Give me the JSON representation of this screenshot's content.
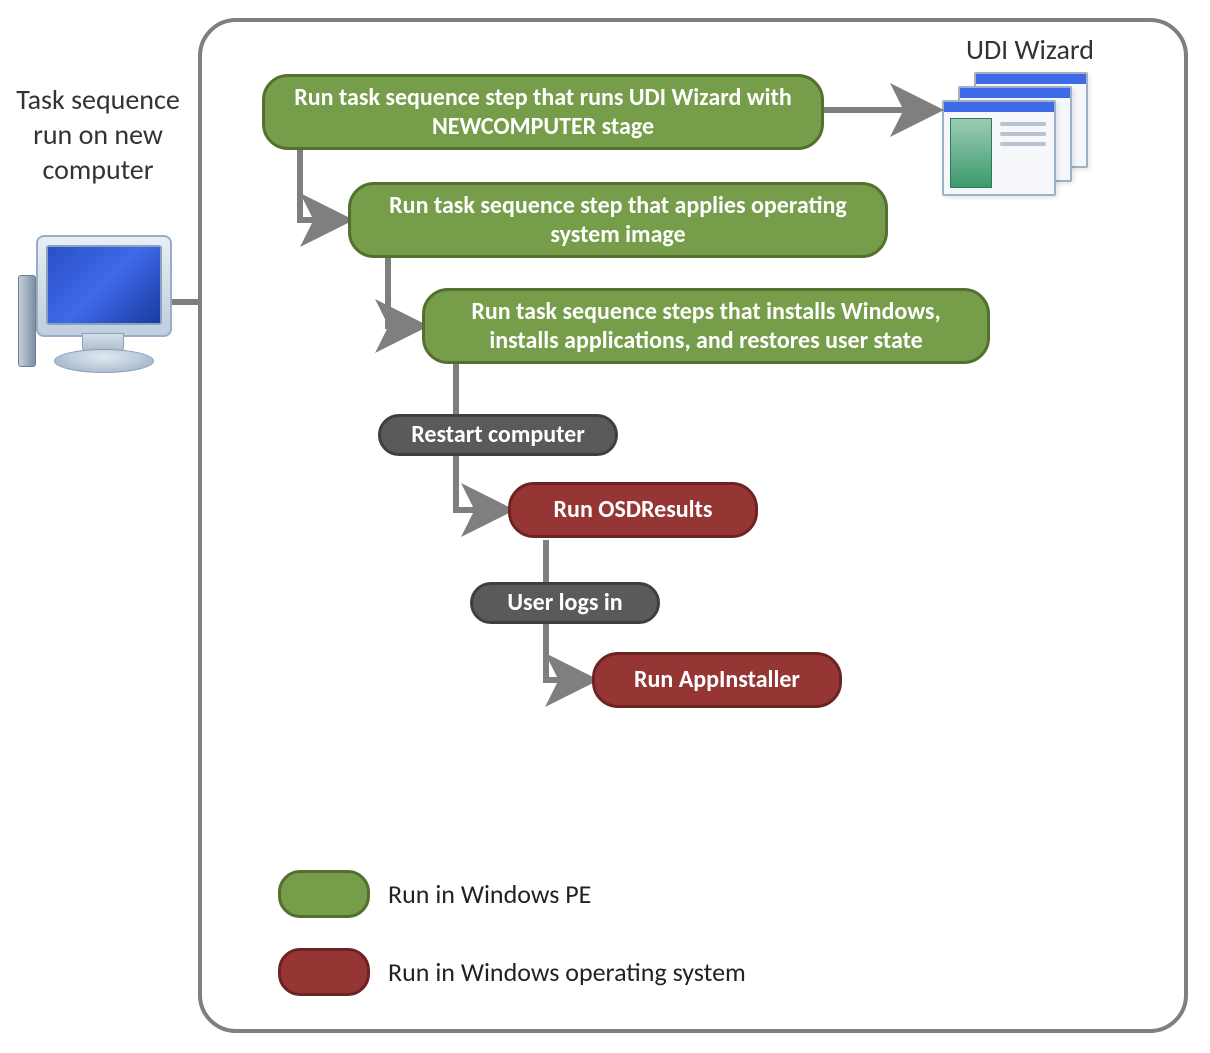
{
  "side_label": "Task sequence run on new computer",
  "wizard_label": "UDI Wizard",
  "steps": {
    "s1": "Run task sequence step  that runs UDI Wizard with NEWCOMPUTER  stage",
    "s2": "Run  task sequence step that applies operating system image",
    "s3": "Run task sequence steps that installs Windows, installs applications, and restores user state",
    "s4": "Restart computer",
    "s5": "Run OSDResults",
    "s6": "User logs in",
    "s7": "Run AppInstaller"
  },
  "legend": {
    "pe": "Run in Windows  PE",
    "os": "Run in Windows operating system"
  },
  "colors": {
    "green_fill": "#769d49",
    "green_border": "#53702f",
    "red_fill": "#953635",
    "red_border": "#6c2322",
    "gray_fill": "#5a5a5a",
    "gray_border": "#3f3f3f",
    "connector": "#7f7f7f"
  }
}
